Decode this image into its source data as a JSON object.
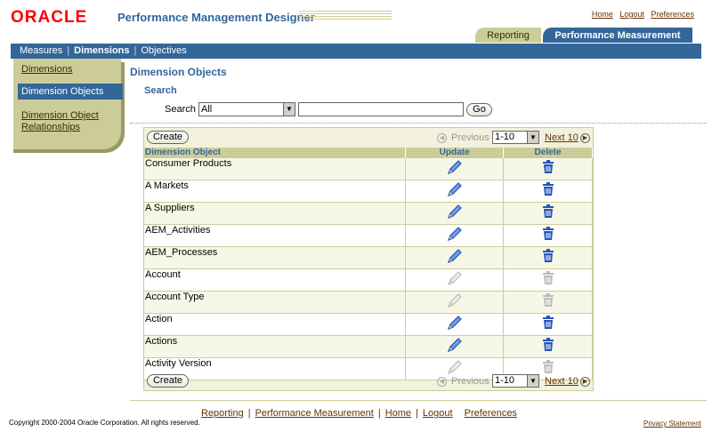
{
  "header": {
    "logo": "ORACLE",
    "app_title": "Performance Management Designer",
    "global_links": [
      "Home",
      "Logout",
      "Preferences"
    ]
  },
  "tabs": {
    "reporting": "Reporting",
    "performance_measurement": "Performance Measurement"
  },
  "subnav": {
    "measures": "Measures",
    "dimensions": "Dimensions",
    "objectives": "Objectives"
  },
  "sidenav": {
    "items": [
      "Dimensions",
      "Dimension Objects",
      "Dimension Object",
      "Relationships"
    ]
  },
  "main": {
    "page_title": "Dimension Objects",
    "search_heading": "Search",
    "search_label": "Search",
    "search_select_value": "All",
    "search_input_value": "",
    "go_label": "Go",
    "create_label": "Create",
    "nav": {
      "previous": "Previous",
      "range": "1-10",
      "next": "Next 10"
    },
    "columns": [
      "Dimension Object",
      "Update",
      "Delete"
    ],
    "rows": [
      {
        "name": "Consumer Products",
        "enabled": true
      },
      {
        "name": "A Markets",
        "enabled": true
      },
      {
        "name": "A Suppliers",
        "enabled": true
      },
      {
        "name": "AEM_Activities",
        "enabled": true
      },
      {
        "name": "AEM_Processes",
        "enabled": true
      },
      {
        "name": "Account",
        "enabled": false
      },
      {
        "name": "Account Type",
        "enabled": false
      },
      {
        "name": "Action",
        "enabled": true
      },
      {
        "name": "Actions",
        "enabled": true
      },
      {
        "name": "Activity Version",
        "enabled": false
      }
    ]
  },
  "footer": {
    "links": [
      "Reporting",
      "Performance Measurement",
      "Home",
      "Logout",
      "Preferences"
    ],
    "copyright": "Copyright 2000-2004 Oracle Corporation. All rights reserved.",
    "privacy": "Privacy Statement"
  },
  "colors": {
    "brand_blue": "#336699",
    "oracle_red": "#ff0000",
    "tan": "#cccc99",
    "link_brown": "#663300",
    "icon_enabled": "#2255bb",
    "icon_disabled": "#bbbbbb"
  }
}
